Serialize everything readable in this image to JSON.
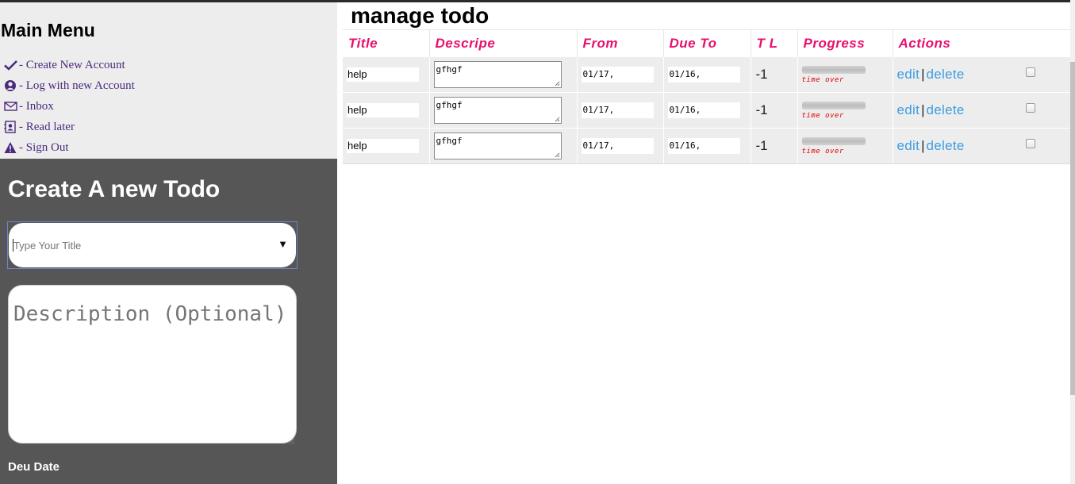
{
  "sidebar": {
    "title": "Main Menu",
    "items": [
      {
        "label": "- Create New Account",
        "icon": "check-icon"
      },
      {
        "label": "- Log with new Account",
        "icon": "user-circle-icon"
      },
      {
        "label": "- Inbox",
        "icon": "envelope-icon"
      },
      {
        "label": "- Read later",
        "icon": "contact-card-icon"
      },
      {
        "label": "- Sign Out",
        "icon": "warning-icon"
      }
    ]
  },
  "create": {
    "title": "Create A new Todo",
    "title_placeholder": "Type Your Title",
    "description_placeholder": "Description (Optional)",
    "due_label": "Deu Date"
  },
  "main": {
    "title": "manage todo",
    "headers": [
      "Title",
      "Descripe",
      "From",
      "Due To",
      "T L",
      "Progress",
      "Actions"
    ],
    "rows": [
      {
        "title": "help",
        "description": "gfhgf",
        "from": "01/17,",
        "due": "01/16,",
        "tl": "-1",
        "progress_text": "time over",
        "edit": "edit",
        "delete": "delete"
      },
      {
        "title": "help",
        "description": "gfhgf",
        "from": "01/17,",
        "due": "01/16,",
        "tl": "-1",
        "progress_text": "time over",
        "edit": "edit",
        "delete": "delete"
      },
      {
        "title": "help",
        "description": "gfhgf",
        "from": "01/17,",
        "due": "01/16,",
        "tl": "-1",
        "progress_text": "time over",
        "edit": "edit",
        "delete": "delete"
      }
    ],
    "separator": "|"
  },
  "colors": {
    "menu_text": "#4b2b7d",
    "header_text": "#e8106e",
    "link": "#3d9de2",
    "panel_bg": "#565656",
    "sidebar_bg": "#ededed",
    "time_over": "#e00000"
  }
}
